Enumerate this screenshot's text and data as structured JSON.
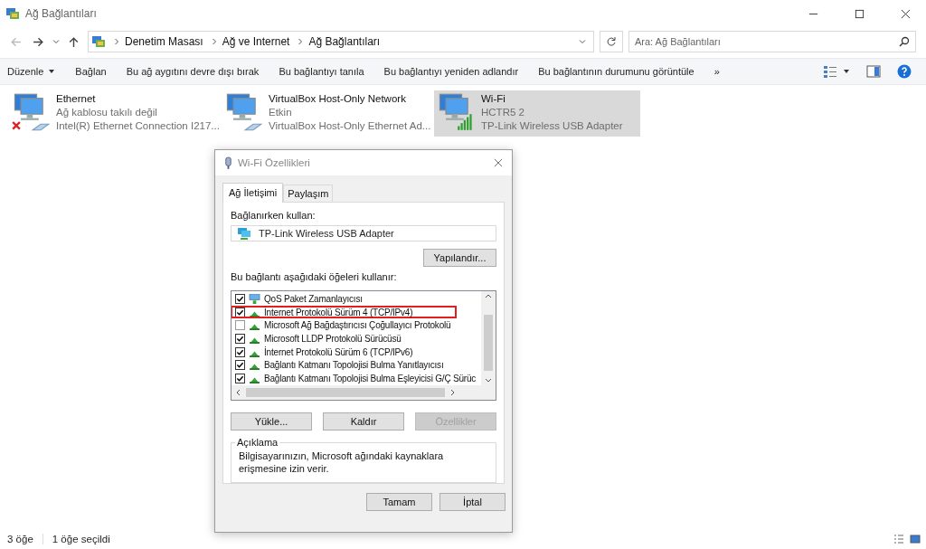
{
  "window": {
    "title": "Ağ Bağlantıları"
  },
  "address": {
    "crumbs": [
      "Denetim Masası",
      "Ağ ve Internet",
      "Ağ Bağlantıları"
    ],
    "search_placeholder": "Ara: Ağ Bağlantıları"
  },
  "commands": [
    {
      "label": "Düzenle",
      "dropdown": true
    },
    {
      "label": "Bağlan",
      "dropdown": false
    },
    {
      "label": "Bu ağ aygıtını devre dışı bırak",
      "dropdown": false
    },
    {
      "label": "Bu bağlantıyı tanıla",
      "dropdown": false
    },
    {
      "label": "Bu bağlantıyı yeniden adlandır",
      "dropdown": false
    },
    {
      "label": "Bu bağlantının durumunu görüntüle",
      "dropdown": false
    },
    {
      "label": "»",
      "dropdown": false
    }
  ],
  "adapters": [
    {
      "kind": "unplugged",
      "name": "Ethernet",
      "status": "Ağ kablosu takılı değil",
      "device": "Intel(R) Ethernet Connection I217...",
      "selected": false
    },
    {
      "kind": "ethernet",
      "name": "VirtualBox Host-Only Network",
      "status": "Etkin",
      "device": "VirtualBox Host-Only Ethernet Ad...",
      "selected": false
    },
    {
      "kind": "wifi",
      "name": "Wi-Fi",
      "status": "HCTR5 2",
      "device": "TP-Link Wireless USB Adapter",
      "selected": true
    }
  ],
  "dialog": {
    "title": "Wi-Fi Özellikleri",
    "tabs": [
      {
        "label": "Ağ İletişimi",
        "selected": true
      },
      {
        "label": "Paylaşım",
        "selected": false
      }
    ],
    "connect_label": "Bağlanırken kullan:",
    "adapter": "TP-Link Wireless USB Adapter",
    "configure_button": "Yapılandır...",
    "items_label": "Bu bağlantı aşağıdaki öğeleri kullanır:",
    "items": [
      {
        "kind": "service",
        "label": "QoS Paket Zamanlayıcısı",
        "checked": true,
        "highlighted": false
      },
      {
        "kind": "protocol",
        "label": "İnternet Protokolü Sürüm 4 (TCP/IPv4)",
        "checked": true,
        "highlighted": true
      },
      {
        "kind": "protocol",
        "label": "Microsoft Ağ Bağdaştırıcısı Çoğullayıcı Protokolü",
        "checked": false,
        "highlighted": false
      },
      {
        "kind": "protocol",
        "label": "Microsoft LLDP Protokolü Sürücüsü",
        "checked": true,
        "highlighted": false
      },
      {
        "kind": "protocol",
        "label": "İnternet Protokolü Sürüm 6 (TCP/IPv6)",
        "checked": true,
        "highlighted": false
      },
      {
        "kind": "protocol",
        "label": "Bağlantı Katmanı Topolojisi Bulma Yanıtlayıcısı",
        "checked": true,
        "highlighted": false
      },
      {
        "kind": "protocol",
        "label": "Bağlantı Katmanı Topolojisi Bulma Eşleyicisi G/Ç Sürüc",
        "checked": true,
        "highlighted": false
      }
    ],
    "item_buttons": [
      {
        "label": "Yükle...",
        "disabled": false
      },
      {
        "label": "Kaldır",
        "disabled": false
      },
      {
        "label": "Özellikler",
        "disabled": true
      }
    ],
    "description": {
      "title": "Açıklama",
      "text": "Bilgisayarınızın, Microsoft ağındaki kaynaklara erişmesine izin verir."
    },
    "footer_buttons": [
      "Tamam",
      "İptal"
    ]
  },
  "status_bar": [
    "3 öğe",
    "1 öğe seçildi"
  ]
}
